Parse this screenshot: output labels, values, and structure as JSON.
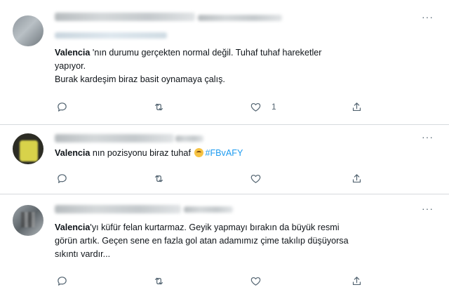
{
  "tweets": [
    {
      "team": "Valencia",
      "text_after": " 'nın durumu gerçekten normal değil. Tuhaf tuhaf hareketler",
      "line2": "yapıyor.",
      "line3": "Burak kardeşim biraz basit oynamaya çalış.",
      "like_count": "1"
    },
    {
      "team": "Valencia",
      "text_after": " nın pozisyonu biraz tuhaf ",
      "hashtag": "#FBvAFY",
      "like_count": ""
    },
    {
      "team": "Valencia",
      "text_after": "'yı küfür felan kurtarmaz. Geyik yapmayı bırakın da büyük resmi",
      "line2": "görün artık. Geçen sene en fazla gol atan adamımız çime takılıp düşüyorsa",
      "line3": "sıkıntı vardır...",
      "like_count": ""
    }
  ],
  "icons": {
    "more": "more-options-icon",
    "reply": "reply-icon",
    "retweet": "retweet-icon",
    "like": "like-icon",
    "share": "share-icon",
    "emoji": "thinking-face-emoji"
  },
  "colors": {
    "hashtag": "#1d9bf0",
    "muted": "#536471",
    "divider": "#d6dadd"
  }
}
